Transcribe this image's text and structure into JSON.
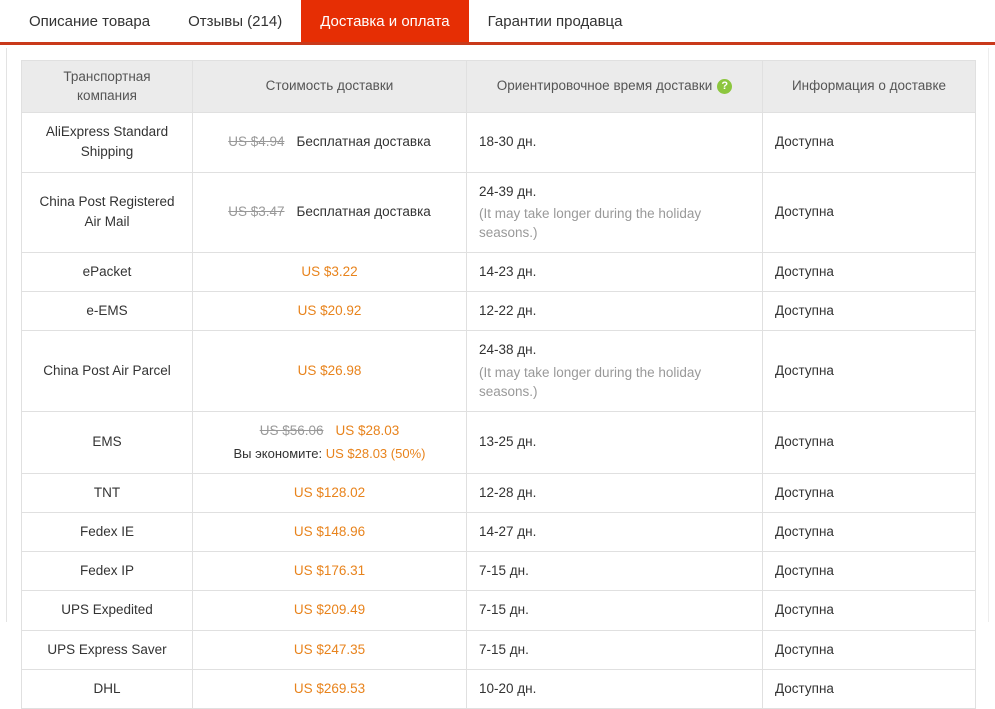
{
  "tabs": [
    {
      "label": "Описание товара",
      "active": false
    },
    {
      "label": "Отзывы (214)",
      "active": false
    },
    {
      "label": "Доставка и оплата",
      "active": true
    },
    {
      "label": "Гарантии продавца",
      "active": false
    }
  ],
  "accent_colors": {
    "active_tab_bg": "#e62e04",
    "strip_underline": "#c9391a",
    "price_orange": "#e8831c",
    "help_icon_green": "#8cc63e",
    "header_bg": "#ebebeb",
    "border": "#e0e0e0",
    "muted_text": "#999999"
  },
  "table": {
    "headers": {
      "company": "Транспортная компания",
      "cost": "Стоимость доставки",
      "time": "Ориентировочное время доставки",
      "time_help_icon": "help-icon",
      "time_help_glyph": "?",
      "info": "Информация о доставке"
    },
    "rows": [
      {
        "company": "AliExpress Standard Shipping",
        "old_price": "US $4.94",
        "price": "",
        "free_label": "Бесплатная доставка",
        "save_label": "",
        "save_value": "",
        "time": "18-30 дн.",
        "time_note": "",
        "info": "Доступна"
      },
      {
        "company": "China Post Registered Air Mail",
        "old_price": "US $3.47",
        "price": "",
        "free_label": "Бесплатная доставка",
        "save_label": "",
        "save_value": "",
        "time": "24-39 дн.",
        "time_note": "(It may take longer during the holiday seasons.)",
        "info": "Доступна"
      },
      {
        "company": "ePacket",
        "old_price": "",
        "price": "US $3.22",
        "free_label": "",
        "save_label": "",
        "save_value": "",
        "time": "14-23 дн.",
        "time_note": "",
        "info": "Доступна"
      },
      {
        "company": "e-EMS",
        "old_price": "",
        "price": "US $20.92",
        "free_label": "",
        "save_label": "",
        "save_value": "",
        "time": "12-22 дн.",
        "time_note": "",
        "info": "Доступна"
      },
      {
        "company": "China Post Air Parcel",
        "old_price": "",
        "price": "US $26.98",
        "free_label": "",
        "save_label": "",
        "save_value": "",
        "time": "24-38 дн.",
        "time_note": "(It may take longer during the holiday seasons.)",
        "info": "Доступна"
      },
      {
        "company": "EMS",
        "old_price": "US $56.06",
        "price": "US $28.03",
        "free_label": "",
        "save_label": "Вы экономите:",
        "save_value": "US $28.03 (50%)",
        "time": "13-25 дн.",
        "time_note": "",
        "info": "Доступна"
      },
      {
        "company": "TNT",
        "old_price": "",
        "price": "US $128.02",
        "free_label": "",
        "save_label": "",
        "save_value": "",
        "time": "12-28 дн.",
        "time_note": "",
        "info": "Доступна"
      },
      {
        "company": "Fedex IE",
        "old_price": "",
        "price": "US $148.96",
        "free_label": "",
        "save_label": "",
        "save_value": "",
        "time": "14-27 дн.",
        "time_note": "",
        "info": "Доступна"
      },
      {
        "company": "Fedex IP",
        "old_price": "",
        "price": "US $176.31",
        "free_label": "",
        "save_label": "",
        "save_value": "",
        "time": "7-15 дн.",
        "time_note": "",
        "info": "Доступна"
      },
      {
        "company": "UPS Expedited",
        "old_price": "",
        "price": "US $209.49",
        "free_label": "",
        "save_label": "",
        "save_value": "",
        "time": "7-15 дн.",
        "time_note": "",
        "info": "Доступна"
      },
      {
        "company": "UPS Express Saver",
        "old_price": "",
        "price": "US $247.35",
        "free_label": "",
        "save_label": "",
        "save_value": "",
        "time": "7-15 дн.",
        "time_note": "",
        "info": "Доступна"
      },
      {
        "company": "DHL",
        "old_price": "",
        "price": "US $269.53",
        "free_label": "",
        "save_label": "",
        "save_value": "",
        "time": "10-20 дн.",
        "time_note": "",
        "info": "Доступна"
      }
    ]
  }
}
